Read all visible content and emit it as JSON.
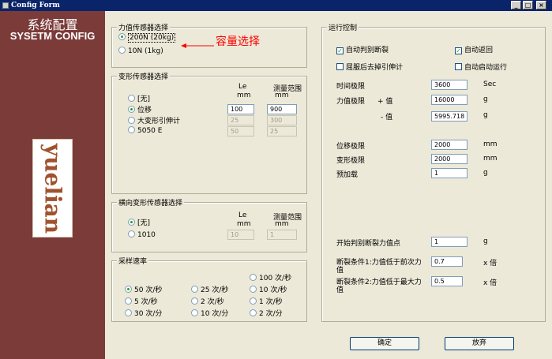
{
  "window": {
    "title": "Config Form"
  },
  "left_panel": {
    "title_cn": "系统配置",
    "title_en": "SYSETM CONFIG",
    "logo_text": "yuelian"
  },
  "force_sensor": {
    "legend": "力值传感器选择",
    "options": [
      "200N (20kg)",
      "10N (1kg)"
    ],
    "selected": 0,
    "annotation": "容量选择"
  },
  "deform_sensor": {
    "legend": "变形传感器选择",
    "col_le": "Le",
    "col_le_unit": "mm",
    "col_range": "测量范围",
    "col_range_unit": "mm",
    "rows": [
      {
        "label": "[无]",
        "le": "",
        "range": "",
        "selected": false,
        "enabled": false
      },
      {
        "label": "位移",
        "le": "100",
        "range": "900",
        "selected": true,
        "enabled": true
      },
      {
        "label": "大变形引伸计",
        "le": "25",
        "range": "300",
        "selected": false,
        "enabled": false
      },
      {
        "label": "5050 E",
        "le": "50",
        "range": "25",
        "selected": false,
        "enabled": false
      }
    ]
  },
  "lateral_sensor": {
    "legend": "横向变形传感器选择",
    "col_le": "Le",
    "col_le_unit": "mm",
    "col_range": "测量范围",
    "col_range_unit": "mm",
    "rows": [
      {
        "label": "[无]",
        "le": "",
        "range": "",
        "selected": true
      },
      {
        "label": "1010",
        "le": "10",
        "range": "1",
        "selected": false
      }
    ]
  },
  "sample_rate": {
    "legend": "采样速率",
    "options": [
      {
        "label": "100 次/秒",
        "selected": false
      },
      {
        "label": "50 次/秒",
        "selected": true
      },
      {
        "label": "25 次/秒",
        "selected": false
      },
      {
        "label": "10 次/秒",
        "selected": false
      },
      {
        "label": "5 次/秒",
        "selected": false
      },
      {
        "label": "2 次/秒",
        "selected": false
      },
      {
        "label": "1 次/秒",
        "selected": false
      },
      {
        "label": "30 次/分",
        "selected": false
      },
      {
        "label": "10 次/分",
        "selected": false
      },
      {
        "label": "2 次/分",
        "selected": false
      }
    ]
  },
  "run_control": {
    "legend": "运行控制",
    "checks": [
      {
        "label": "自动判别断裂",
        "checked": true
      },
      {
        "label": "自动返回",
        "checked": true
      },
      {
        "label": "屈服后去掉引伸计",
        "checked": false
      },
      {
        "label": "自动启动运行",
        "checked": false
      }
    ],
    "time_limit": {
      "label": "时间极限",
      "value": "3600",
      "unit": "Sec"
    },
    "force_limit": {
      "label": "力值极限",
      "plus_label": "+ 值",
      "plus_value": "16000",
      "minus_label": "- 值",
      "minus_value": "5995.718",
      "unit": "g"
    },
    "disp_limit": {
      "label": "位移极限",
      "value": "2000",
      "unit": "mm"
    },
    "deform_limit": {
      "label": "变形极限",
      "value": "2000",
      "unit": "mm"
    },
    "preload": {
      "label": "预加载",
      "value": "1",
      "unit": "g"
    },
    "break_start": {
      "label": "开始判别断裂力值点",
      "value": "1",
      "unit": "g"
    },
    "break_cond1": {
      "label_line1": "断裂条件1:力值低于前次力",
      "label_line2": "值",
      "value": "0.7",
      "unit": "x 倍"
    },
    "break_cond2": {
      "label_line1": "断裂条件2:力值低于最大力",
      "label_line2": "值",
      "value": "0.5",
      "unit": "x 倍"
    }
  },
  "buttons": {
    "ok": "确定",
    "cancel": "放弃"
  }
}
